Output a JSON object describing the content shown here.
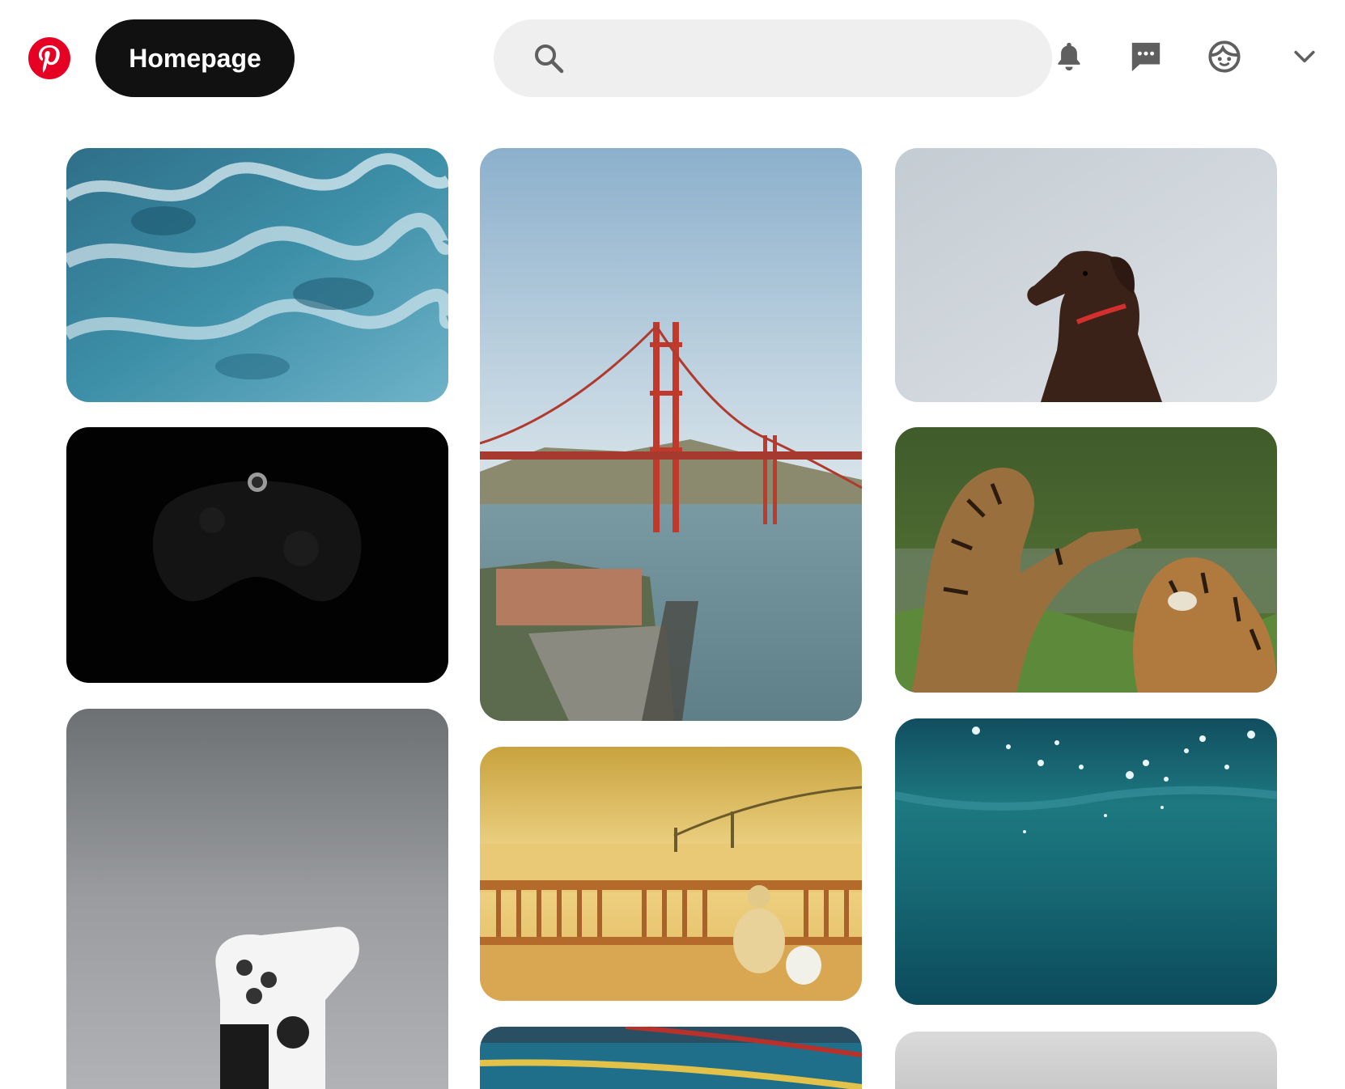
{
  "header": {
    "home_label": "Homepage",
    "search": {
      "value": "",
      "placeholder": ""
    },
    "icons": [
      "pinterest-logo",
      "search-icon",
      "bell-icon",
      "chat-icon",
      "face-icon",
      "chevron-down-icon"
    ],
    "brand_color": "#e60023"
  },
  "feed": {
    "columns": 3,
    "pins": [
      {
        "column": 1,
        "order": 1,
        "subject": "ocean-waves"
      },
      {
        "column": 1,
        "order": 2,
        "subject": "xbox-controller"
      },
      {
        "column": 1,
        "order": 3,
        "subject": "playstation-controller"
      },
      {
        "column": 2,
        "order": 1,
        "subject": "golden-gate-bridge"
      },
      {
        "column": 2,
        "order": 2,
        "subject": "bay-bridge-pier"
      },
      {
        "column": 2,
        "order": 3,
        "subject": "swimming-pool"
      },
      {
        "column": 3,
        "order": 1,
        "subject": "brown-labrador"
      },
      {
        "column": 3,
        "order": 2,
        "subject": "tigers-playing"
      },
      {
        "column": 3,
        "order": 3,
        "subject": "underwater-surface"
      },
      {
        "column": 3,
        "order": 4,
        "subject": "grey-gradient"
      }
    ]
  }
}
